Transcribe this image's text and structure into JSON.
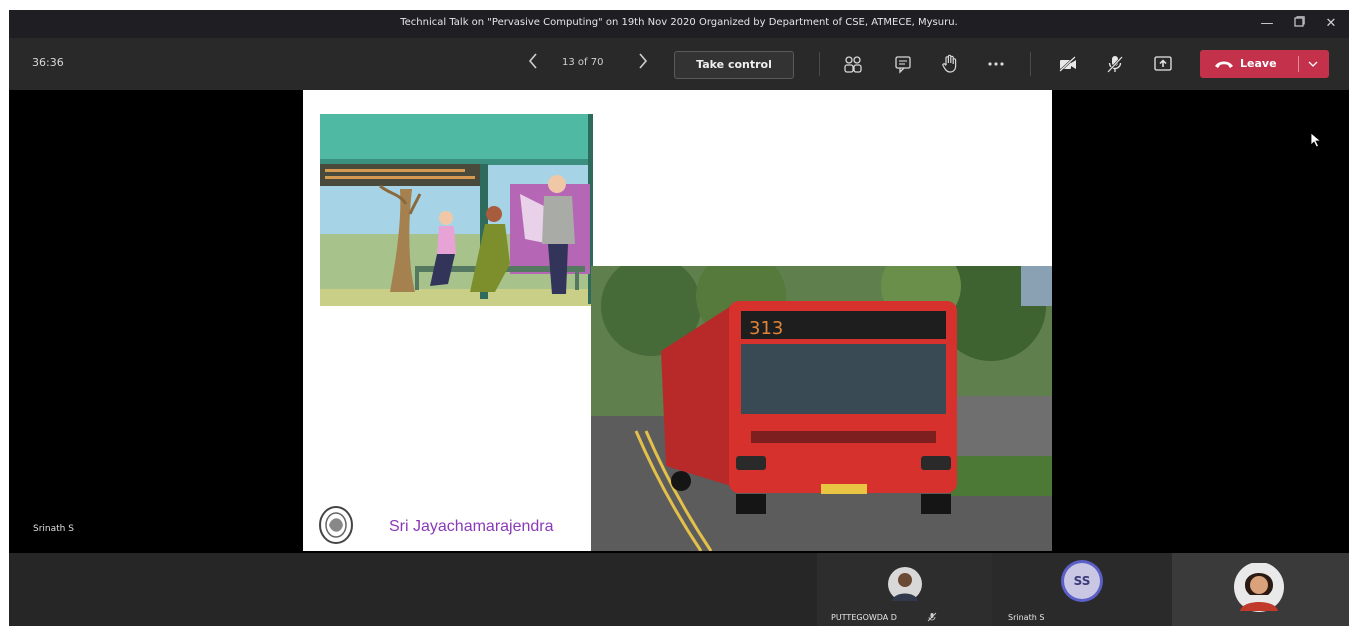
{
  "window": {
    "title": "Technical Talk on \"Pervasive Computing\" on 19th Nov 2020 Organized by Department of CSE, ATMECE, Mysuru."
  },
  "toolbar": {
    "timer": "36:36",
    "slide_counter": "13 of 70",
    "take_control_label": "Take control",
    "leave_label": "Leave",
    "icons": [
      "participants-icon",
      "chat-icon",
      "raise-hand-icon",
      "more-icon",
      "camera-off-icon",
      "mic-off-icon",
      "share-icon",
      "phone-icon",
      "chevron-down-icon"
    ]
  },
  "stage": {
    "presenter_name": "Srinath S",
    "slide": {
      "footer_text": "Sri Jayachamarajendra",
      "bus_route": "313"
    }
  },
  "participants": [
    {
      "name": "PUTTEGOWDA D",
      "muted": true,
      "avatar": "photo"
    },
    {
      "name": "Srinath S",
      "initials": "SS",
      "avatar": "initials"
    },
    {
      "name": "",
      "avatar": "photo"
    }
  ],
  "colors": {
    "leave": "#c4314b",
    "toolbar": "#292929",
    "titlebar": "#1f1f23",
    "accent": "#5b5fc7"
  }
}
